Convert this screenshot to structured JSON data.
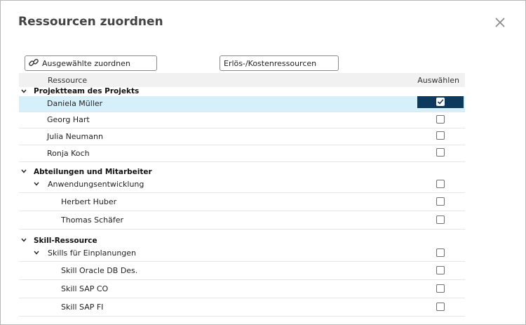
{
  "dialog": {
    "title": "Ressourcen zuordnen",
    "close_icon": "close-icon"
  },
  "toolbar": {
    "assign_label": "Ausgewählte zuordnen",
    "assign_icon": "link-icon",
    "revenue_label": "Erlös-/Kostenressourcen"
  },
  "grid": {
    "headers": {
      "resource": "Ressource",
      "select": "Auswählen"
    },
    "groups": [
      {
        "label": "Projektteam des Projekts",
        "items": [
          {
            "label": "Daniela Müller",
            "checked": true
          },
          {
            "label": "Georg Hart",
            "checked": false
          },
          {
            "label": "Julia Neumann",
            "checked": false
          },
          {
            "label": "Ronja Koch",
            "checked": false
          }
        ]
      },
      {
        "label": "Abteilungen und Mitarbeiter",
        "subgroup": {
          "label": "Anwendungsentwicklung",
          "checked": false
        },
        "items": [
          {
            "label": "Herbert Huber",
            "checked": false
          },
          {
            "label": "Thomas Schäfer",
            "checked": false
          }
        ]
      },
      {
        "label": "Skill-Ressource",
        "subgroup": {
          "label": "Skills für Einplanungen",
          "checked": false
        },
        "items": [
          {
            "label": "Skill Oracle DB Des.",
            "checked": false
          },
          {
            "label": "Skill SAP CO",
            "checked": false
          },
          {
            "label": "Skill SAP FI",
            "checked": false
          }
        ]
      }
    ]
  },
  "colors": {
    "selected_row": "#d6f0fb",
    "checked_cell": "#0d3a5c"
  }
}
